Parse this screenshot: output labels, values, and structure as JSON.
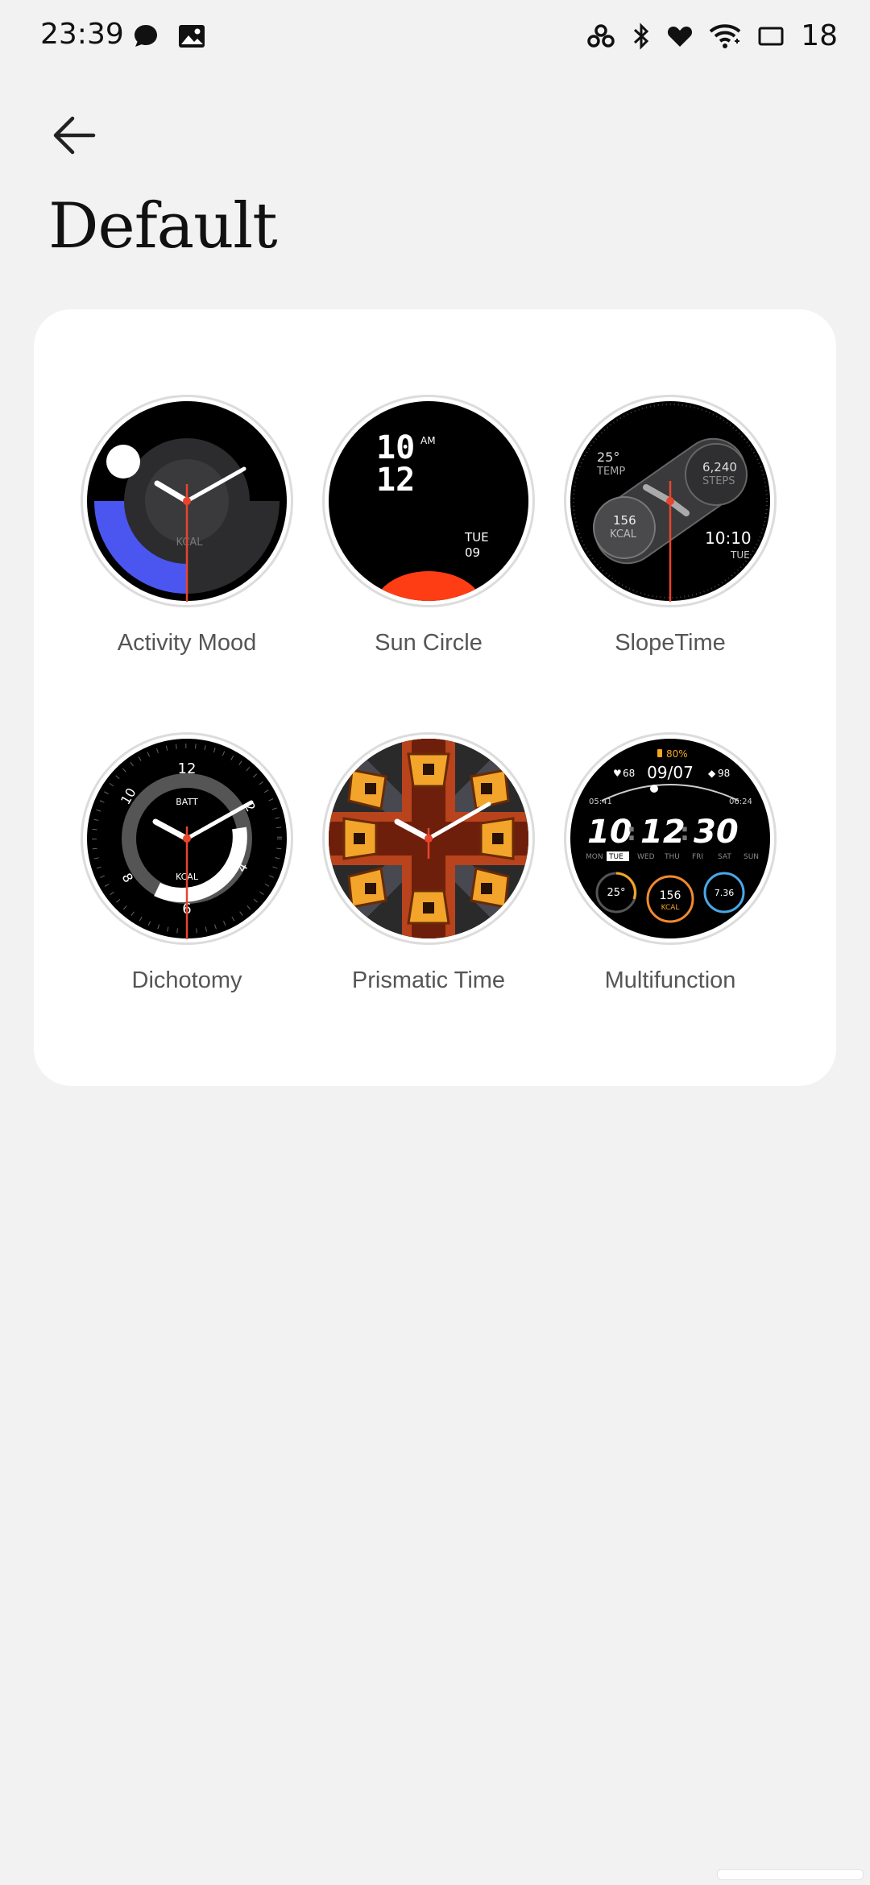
{
  "status_bar": {
    "time": "23:39",
    "battery": "18",
    "left_icons": [
      "chat-bubble-icon",
      "image-icon"
    ],
    "right_icons": [
      "link-icon",
      "bluetooth-icon",
      "heart-icon",
      "wifi-icon",
      "screen-icon"
    ]
  },
  "header": {
    "title": "Default"
  },
  "watch_faces": [
    {
      "name": "Activity Mood",
      "kcal_label": "KCAL"
    },
    {
      "name": "Sun Circle",
      "hour": "10",
      "minute": "12",
      "am": "AM",
      "day": "TUE",
      "date": "09"
    },
    {
      "name": "SlopeTime",
      "temp": "25°",
      "temp_label": "TEMP",
      "steps": "6,240",
      "steps_label": "STEPS",
      "kcal": "156",
      "kcal_label": "KCAL",
      "time": "10:10",
      "day": "TUE"
    },
    {
      "name": "Dichotomy",
      "n12": "12",
      "n10": "10",
      "n8": "8",
      "n6": "6",
      "n4": "4",
      "n2": "2",
      "batt": "BATT",
      "kcal": "KCAL"
    },
    {
      "name": "Prismatic Time"
    },
    {
      "name": "Multifunction",
      "battery": "80%",
      "heart": "68",
      "date": "09/07",
      "spo2": "98",
      "sunrise": "05:41",
      "sunset": "06:24",
      "hh": "10",
      "mm": "12",
      "ss": "30",
      "days": [
        "MON",
        "TUE",
        "WED",
        "THU",
        "FRI",
        "SAT",
        "SUN"
      ],
      "temp": "25°",
      "kcal": "156",
      "kcal_label": "KCAL",
      "dist": "7.36"
    }
  ],
  "colors": {
    "accent_red": "#e8452c",
    "activity_blue": "#4b55f0"
  }
}
